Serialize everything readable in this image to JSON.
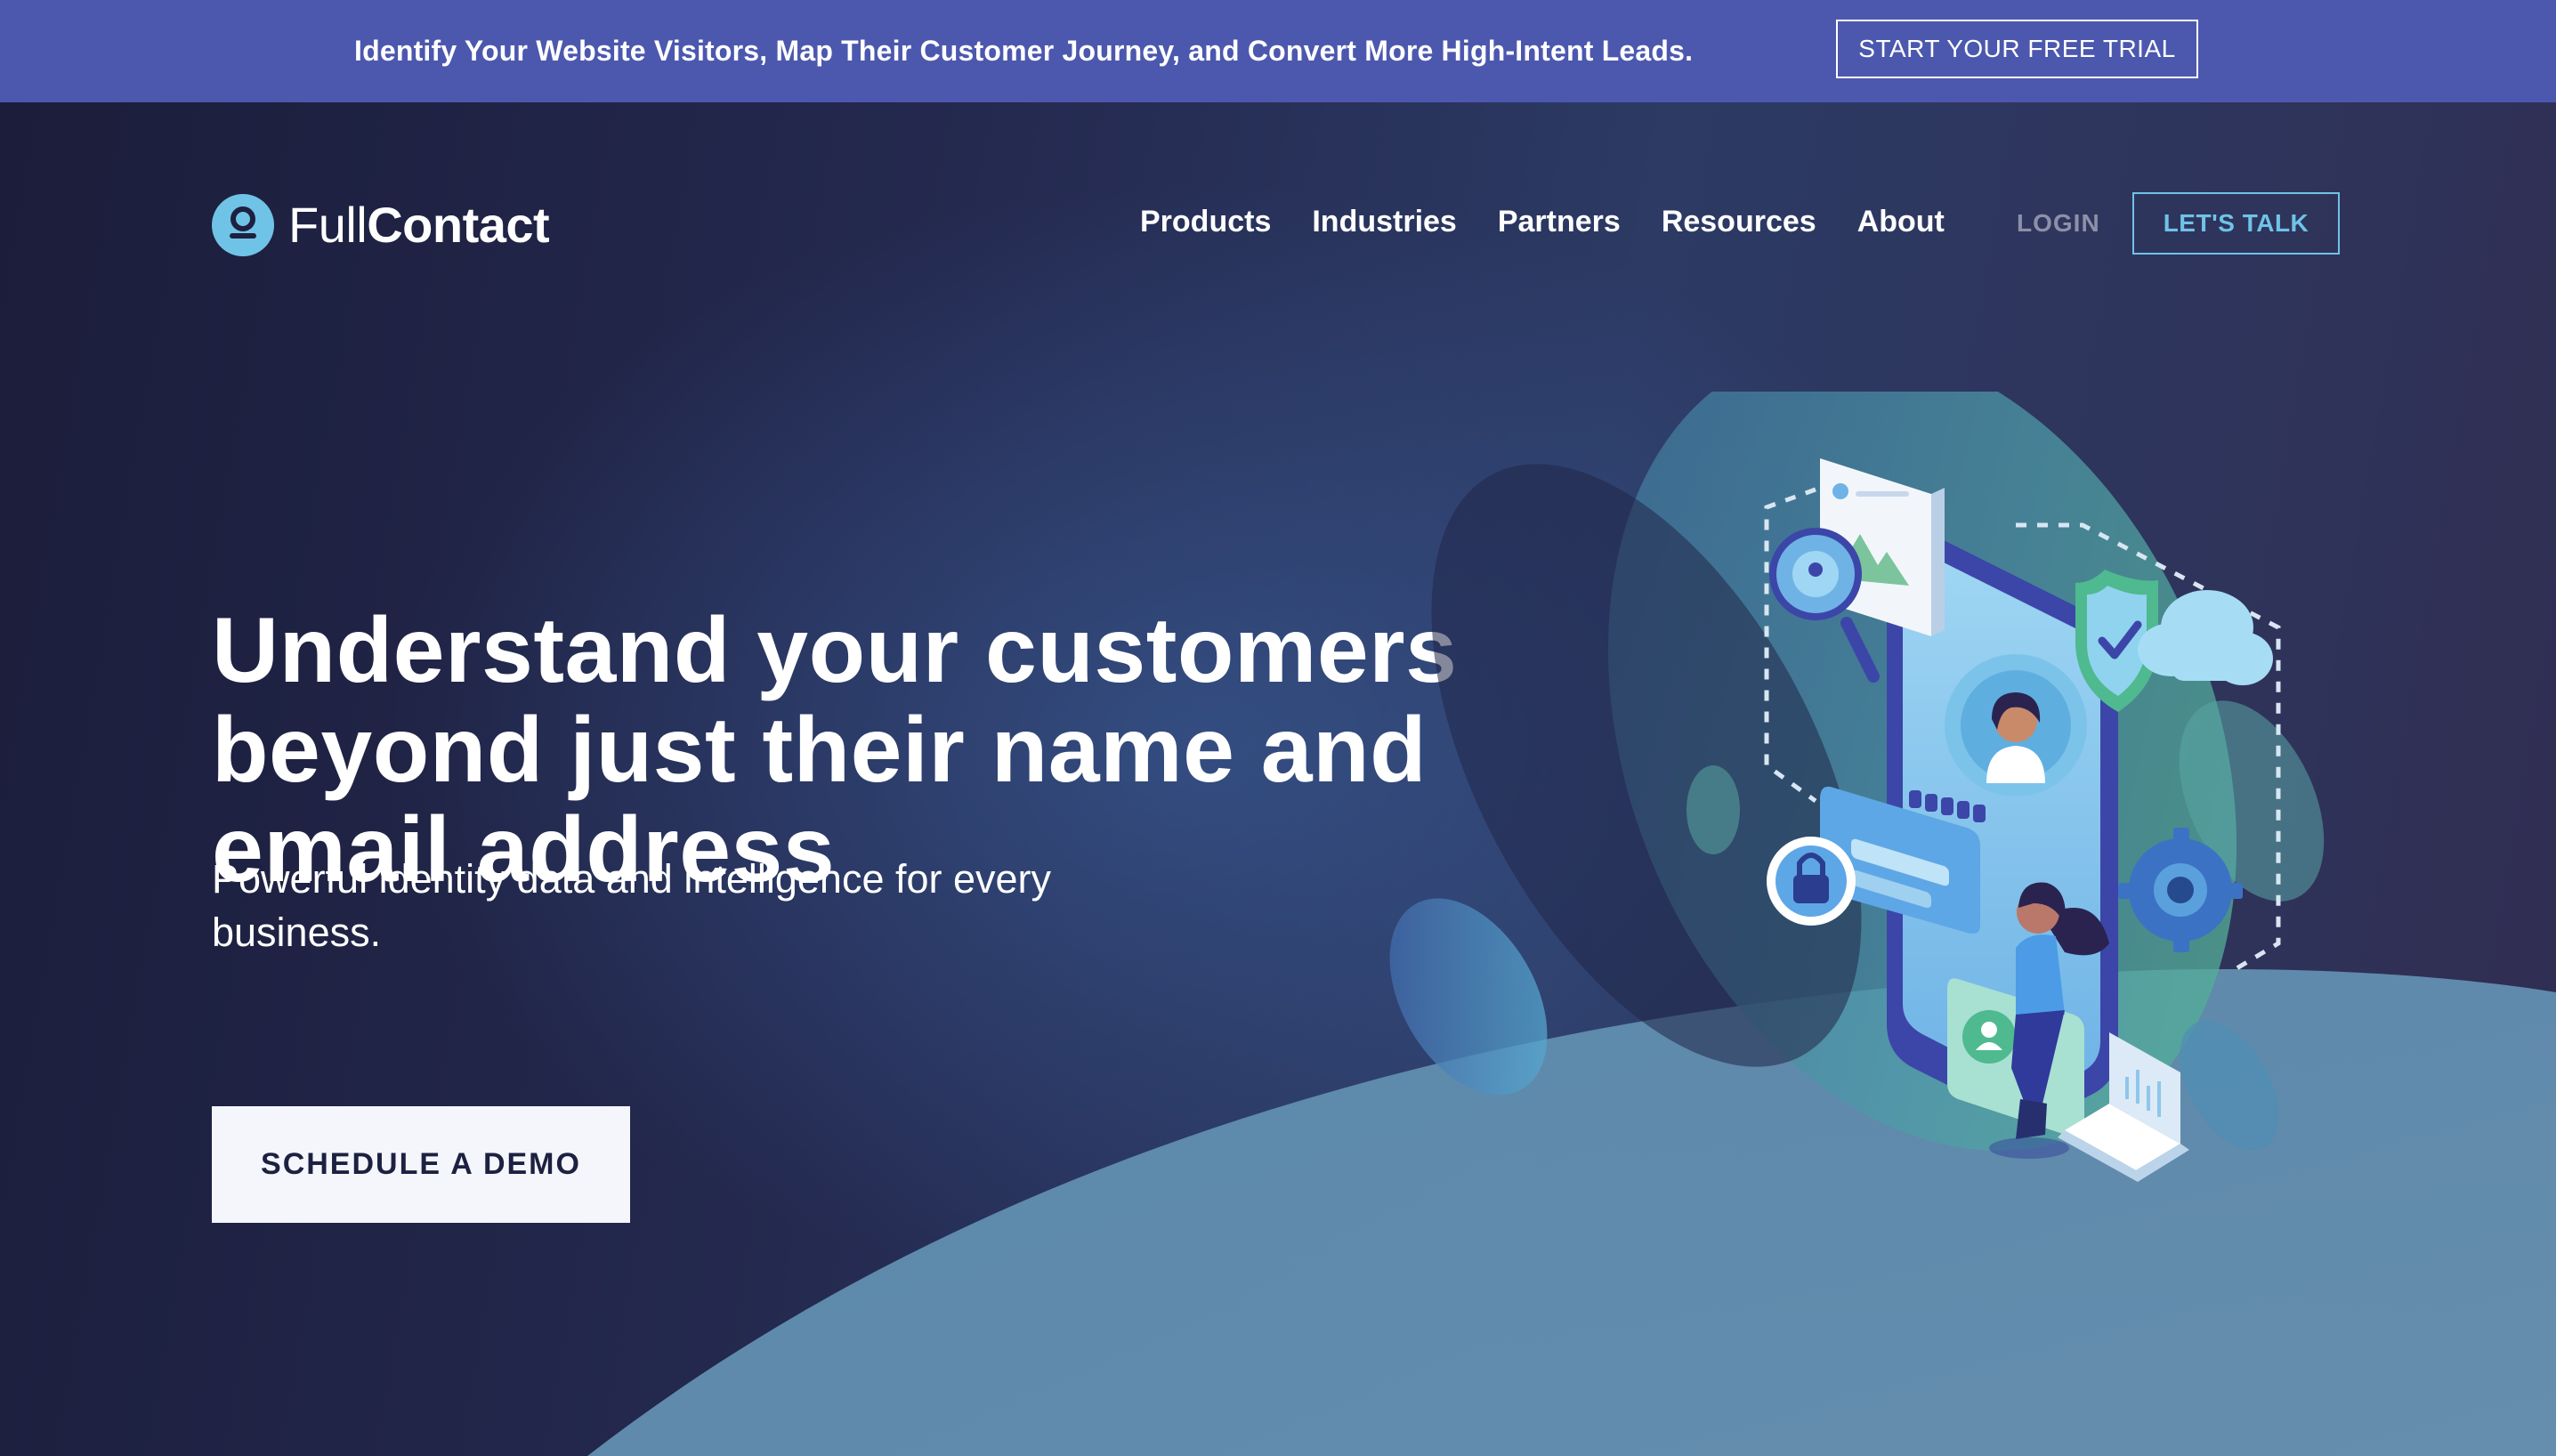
{
  "announcement": {
    "text": "Identify Your Website Visitors, Map Their Customer Journey, and Convert More High-Intent Leads.",
    "cta_label": "START YOUR FREE TRIAL"
  },
  "header": {
    "logo_light": "Full",
    "logo_bold": "Contact",
    "nav": [
      "Products",
      "Industries",
      "Partners",
      "Resources",
      "About"
    ],
    "login_label": "LOGIN",
    "talk_label": "LET'S TALK"
  },
  "hero": {
    "headline": "Understand your customers beyond just their name and email address",
    "subheadline": "Powerful identity data and intelligence for every business.",
    "cta_label": "SCHEDULE A DEMO"
  },
  "colors": {
    "announcement_bg": "#4c58ae",
    "hero_bg": "#22264a",
    "accent": "#6fc3e6",
    "wave": "#6390b0"
  }
}
